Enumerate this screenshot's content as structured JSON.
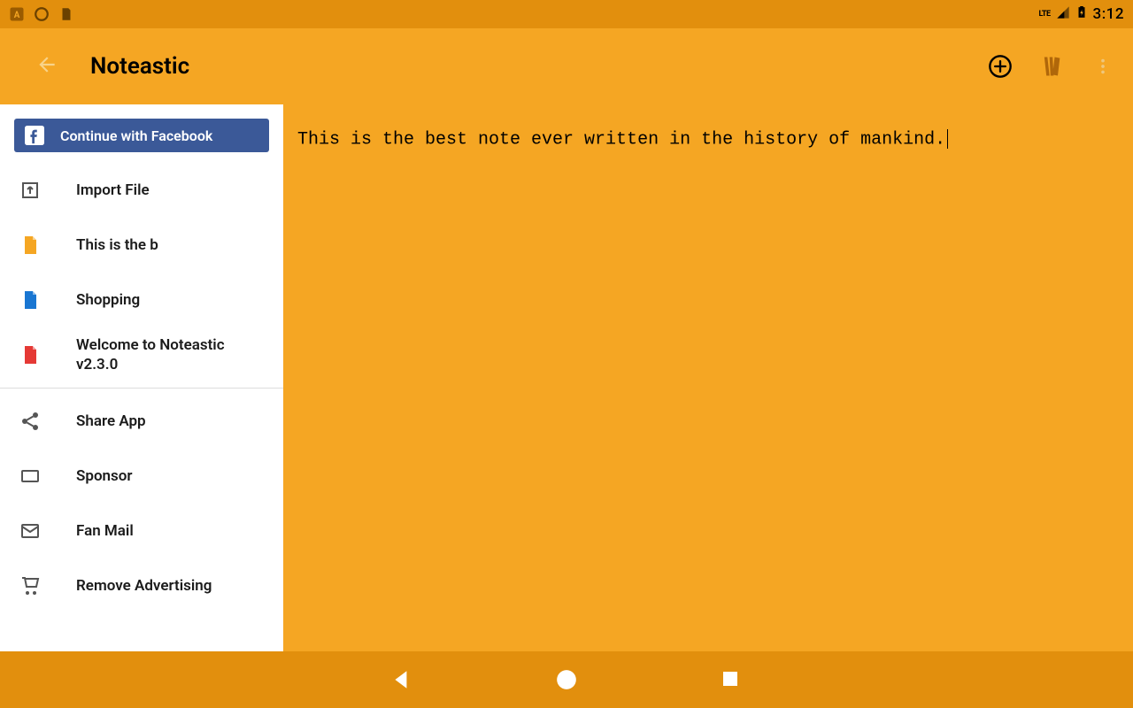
{
  "status": {
    "time": "3:12",
    "network_label": "LTE"
  },
  "appbar": {
    "title": "Noteastic"
  },
  "sidebar": {
    "facebook_label": "Continue with Facebook",
    "import_file": "Import File",
    "notes": [
      {
        "label": "This is the b",
        "icon_color": "#f5a623"
      },
      {
        "label": "Shopping",
        "icon_color": "#1976d2"
      },
      {
        "label": "Welcome to Noteastic v2.3.0",
        "icon_color": "#e53935"
      }
    ],
    "share_app": "Share App",
    "sponsor": "Sponsor",
    "fan_mail": "Fan Mail",
    "remove_ads": "Remove Advertising"
  },
  "editor": {
    "content": "This is the best note ever written in the history of mankind."
  }
}
